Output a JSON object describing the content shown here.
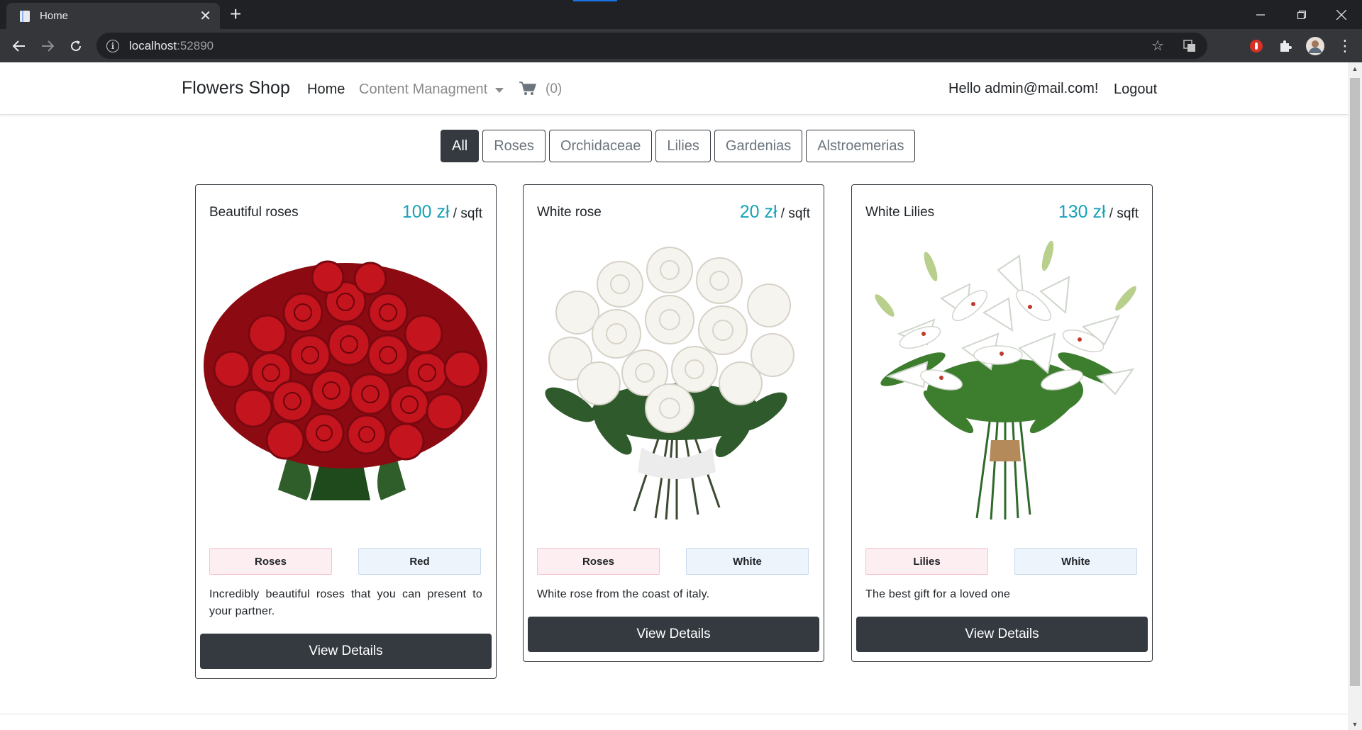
{
  "browser": {
    "tab_title": "Home",
    "url_host": "localhost",
    "url_port": ":52890"
  },
  "navbar": {
    "brand": "Flowers Shop",
    "home": "Home",
    "content_management": "Content Managment",
    "cart_count": "(0)",
    "greeting": "Hello admin@mail.com!",
    "logout": "Logout"
  },
  "filters": [
    "All",
    "Roses",
    "Orchidaceae",
    "Lilies",
    "Gardenias",
    "Alstroemerias"
  ],
  "products": [
    {
      "title": "Beautiful roses",
      "price": "100 zł",
      "unit": " / sqft",
      "category": "Roses",
      "color": "Red",
      "description": "Incredibly beautiful roses that you can present to your partner.",
      "button": "View Details"
    },
    {
      "title": "White rose",
      "price": "20 zł",
      "unit": " / sqft",
      "category": "Roses",
      "color": "White",
      "description": "White rose from the coast of italy.",
      "button": "View Details"
    },
    {
      "title": "White Lilies",
      "price": "130 zł",
      "unit": " / sqft",
      "category": "Lilies",
      "color": "White",
      "description": "The best gift for a loved one",
      "button": "View Details"
    }
  ],
  "colors": {
    "accent_price": "#17a2b8",
    "dark": "#343a40",
    "category_tag_bg": "#fdeef1",
    "color_tag_bg": "#eef4fb"
  }
}
